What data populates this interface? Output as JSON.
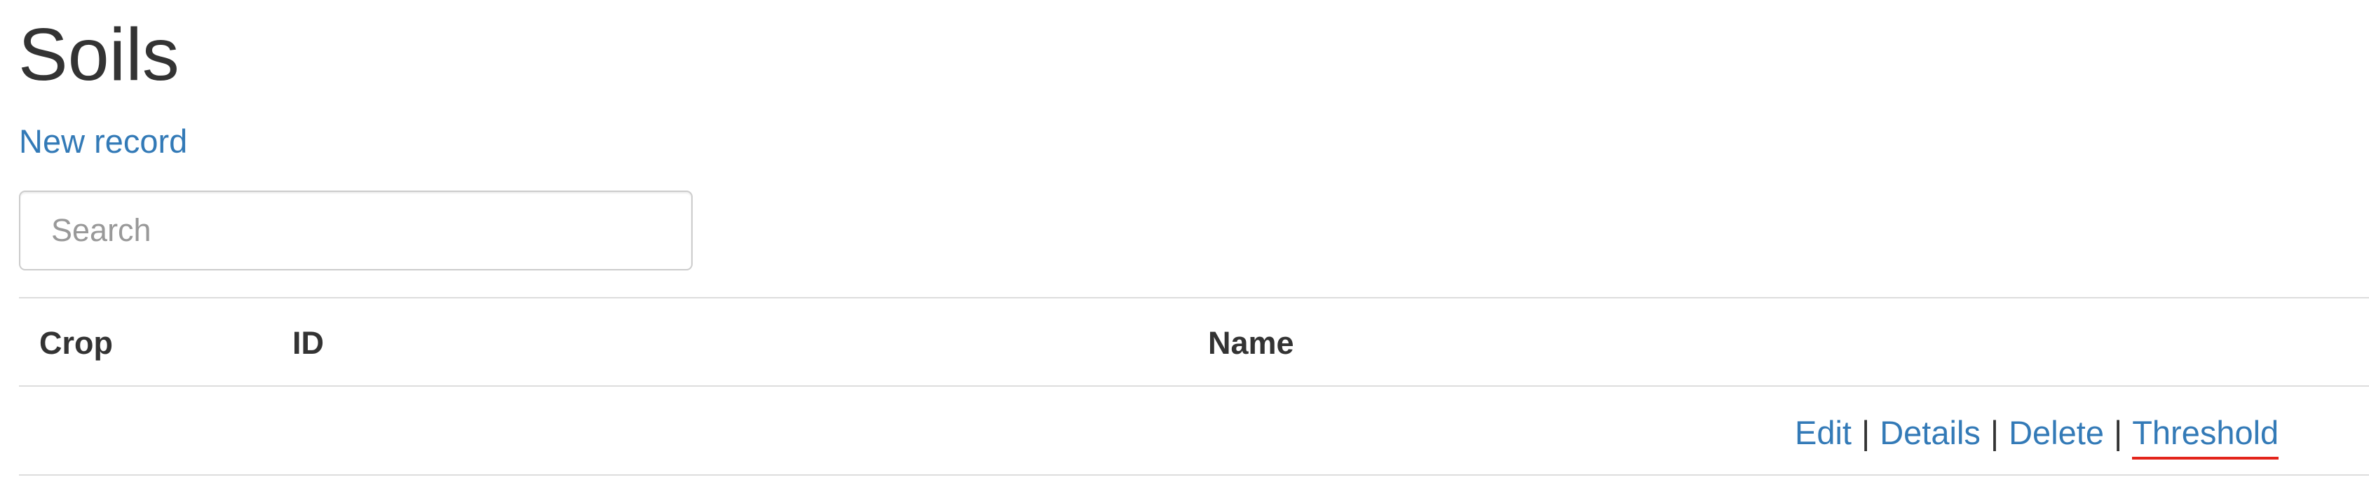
{
  "page": {
    "title": "Soils",
    "new_record_label": "New record"
  },
  "search": {
    "placeholder": "Search",
    "value": ""
  },
  "table": {
    "columns": [
      "Crop",
      "ID",
      "Name"
    ],
    "rows": [
      {
        "crop": "",
        "id": "",
        "name": "",
        "actions": {
          "edit": "Edit",
          "details": "Details",
          "delete": "Delete",
          "threshold": "Threshold",
          "separator": "|"
        }
      }
    ]
  },
  "colors": {
    "link": "#337ab7",
    "text": "#333333",
    "border": "#dddddd",
    "annotation_underline": "#e3241b"
  }
}
